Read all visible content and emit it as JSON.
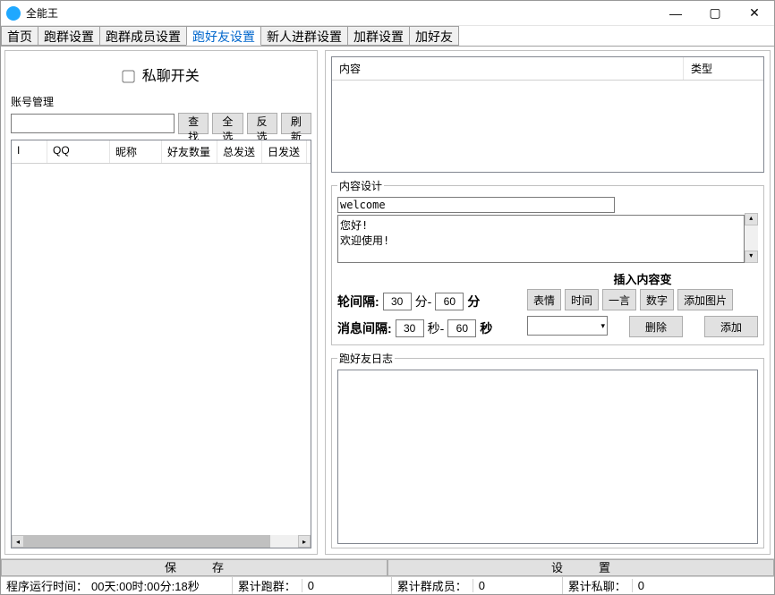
{
  "window": {
    "title": "全能王",
    "icon_text": "⋯"
  },
  "tabs": [
    "首页",
    "跑群设置",
    "跑群成员设置",
    "跑好友设置",
    "新人进群设置",
    "加群设置",
    "加好友"
  ],
  "active_tab_index": 3,
  "left": {
    "switch_label": "私聊开关",
    "account_manage_label": "账号管理",
    "search_value": "",
    "btn_search": "查找",
    "btn_select_all": "全选",
    "btn_invert": "反选",
    "btn_refresh": "刷新",
    "grid_headers": {
      "i": "I",
      "qq": "QQ",
      "nick": "昵称",
      "friends": "好友数量",
      "total": "总发送",
      "daily": "日发送"
    }
  },
  "right": {
    "content_headers": {
      "content": "内容",
      "type": "类型"
    },
    "content_set_legend": "内容设计",
    "content_title": "welcome",
    "content_body": "您好!\n欢迎使用!",
    "round_interval_label": "轮间隔:",
    "round_interval_from": "30",
    "round_interval_sep": "分-",
    "round_interval_to": "60",
    "round_interval_unit": "分",
    "msg_interval_label": "消息间隔:",
    "msg_interval_from": "30",
    "msg_interval_sep": "秒-",
    "msg_interval_to": "60",
    "msg_interval_unit": "秒",
    "insert_var_header": "插入内容变",
    "btn_face": "表情",
    "btn_time": "时间",
    "btn_quote": "一言",
    "btn_number": "数字",
    "btn_add_image": "添加图片",
    "combo_value": "",
    "btn_delete": "删除",
    "btn_add": "添加",
    "log_legend": "跑好友日志"
  },
  "bottom": {
    "btn_save": "保存",
    "btn_settings": "设置"
  },
  "status": {
    "runtime_label": "程序运行时间：",
    "runtime_value": "00天:00时:00分:18秒",
    "run_group_label": "累计跑群：",
    "run_group_value": "0",
    "group_members_label": "累计群成员：",
    "group_members_value": "0",
    "private_chat_label": "累计私聊：",
    "private_chat_value": "0"
  }
}
